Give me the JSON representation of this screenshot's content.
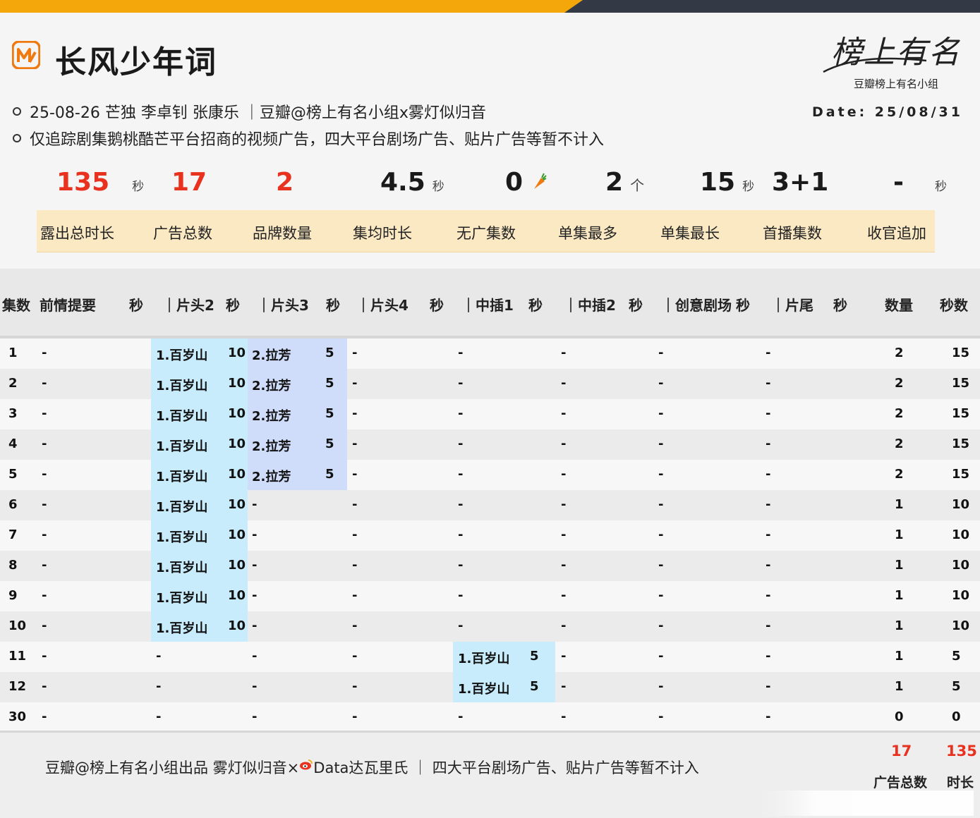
{
  "title": "长风少年词",
  "info_line1": "25-08-26 芒独  李卓钊 张康乐 ｜豆瓣@榜上有名小组x雾灯似归音",
  "info_line2": "仅追踪剧集鹅桃酷芒平台招商的视频广告，四大平台剧场广告、贴片广告等暂不计入",
  "brand": {
    "calligraphy": "榜上有名",
    "subtitle": "豆瓣榜上有名小组",
    "date": "Date: 25/08/31"
  },
  "stats": [
    {
      "value": "135",
      "unit": "秒",
      "label": "露出总时长"
    },
    {
      "value": "17",
      "unit": "",
      "label": "广告总数"
    },
    {
      "value": "2",
      "unit": "",
      "label": "品牌数量"
    },
    {
      "value": "4.5",
      "unit": "秒",
      "label": "集均时长"
    },
    {
      "value": "0",
      "unit": "",
      "label": "无广集数"
    },
    {
      "value": "2",
      "unit": "个",
      "label": "单集最多"
    },
    {
      "value": "15",
      "unit": "秒",
      "label": "单集最长"
    },
    {
      "value": "3+1",
      "unit": "",
      "label": "首播集数"
    },
    {
      "value": "-",
      "unit": "秒",
      "label": "收官追加"
    }
  ],
  "table_headers": [
    "集数",
    "前情提要",
    "秒",
    "｜片头2",
    "秒",
    "｜片头3",
    "秒",
    "｜片头4",
    "秒",
    "｜中插1",
    "秒",
    "｜中插2",
    "秒",
    "｜创意剧场",
    "秒",
    "｜片尾",
    "秒",
    "数量",
    "秒数"
  ],
  "rows": [
    {
      "ep": "1",
      "c": [
        "-",
        "1.百岁山",
        "10",
        "2.拉芳",
        "5",
        "-",
        "-",
        "",
        "-",
        "-",
        "-",
        "2",
        "15"
      ]
    },
    {
      "ep": "2",
      "c": [
        "-",
        "1.百岁山",
        "10",
        "2.拉芳",
        "5",
        "-",
        "-",
        "",
        "-",
        "-",
        "-",
        "2",
        "15"
      ]
    },
    {
      "ep": "3",
      "c": [
        "-",
        "1.百岁山",
        "10",
        "2.拉芳",
        "5",
        "-",
        "-",
        "",
        "-",
        "-",
        "-",
        "2",
        "15"
      ]
    },
    {
      "ep": "4",
      "c": [
        "-",
        "1.百岁山",
        "10",
        "2.拉芳",
        "5",
        "-",
        "-",
        "",
        "-",
        "-",
        "-",
        "2",
        "15"
      ]
    },
    {
      "ep": "5",
      "c": [
        "-",
        "1.百岁山",
        "10",
        "2.拉芳",
        "5",
        "-",
        "-",
        "",
        "-",
        "-",
        "-",
        "2",
        "15"
      ]
    },
    {
      "ep": "6",
      "c": [
        "-",
        "1.百岁山",
        "10",
        "-",
        "",
        "-",
        "-",
        "",
        "-",
        "-",
        "-",
        "1",
        "10"
      ]
    },
    {
      "ep": "7",
      "c": [
        "-",
        "1.百岁山",
        "10",
        "-",
        "",
        "-",
        "-",
        "",
        "-",
        "-",
        "-",
        "1",
        "10"
      ]
    },
    {
      "ep": "8",
      "c": [
        "-",
        "1.百岁山",
        "10",
        "-",
        "",
        "-",
        "-",
        "",
        "-",
        "-",
        "-",
        "1",
        "10"
      ]
    },
    {
      "ep": "9",
      "c": [
        "-",
        "1.百岁山",
        "10",
        "-",
        "",
        "-",
        "-",
        "",
        "-",
        "-",
        "-",
        "1",
        "10"
      ]
    },
    {
      "ep": "10",
      "c": [
        "-",
        "1.百岁山",
        "10",
        "-",
        "",
        "-",
        "-",
        "",
        "-",
        "-",
        "-",
        "1",
        "10"
      ]
    },
    {
      "ep": "11",
      "c": [
        "-",
        "-",
        "",
        "-",
        "",
        "-",
        "1.百岁山",
        "5",
        "-",
        "-",
        "-",
        "1",
        "5"
      ]
    },
    {
      "ep": "12",
      "c": [
        "-",
        "-",
        "",
        "-",
        "",
        "-",
        "1.百岁山",
        "5",
        "-",
        "-",
        "-",
        "1",
        "5"
      ]
    },
    {
      "ep": "30",
      "c": [
        "-",
        "-",
        "",
        "-",
        "",
        "-",
        "-",
        "",
        "-",
        "-",
        "-",
        "0",
        "0"
      ]
    }
  ],
  "footer": {
    "note_a": "豆瓣@榜上有名小组出品 雾灯似归音×",
    "note_b": "Data达瓦里氏 ｜ 四大平台剧场广告、贴片广告等暂不计入",
    "total_ads": "17",
    "total_seconds": "135",
    "total_ads_label": "广告总数",
    "total_seconds_label": "时长"
  },
  "colors": {
    "accent_red": "#e8321f",
    "orange": "#f4a70a",
    "highlight_blue": "#c8ecfb",
    "highlight_periwinkle": "#cfdcfa",
    "label_bg": "#fbe9c4"
  },
  "icons": [
    "mgtv-logo-icon",
    "carrot-icon",
    "weibo-icon"
  ]
}
